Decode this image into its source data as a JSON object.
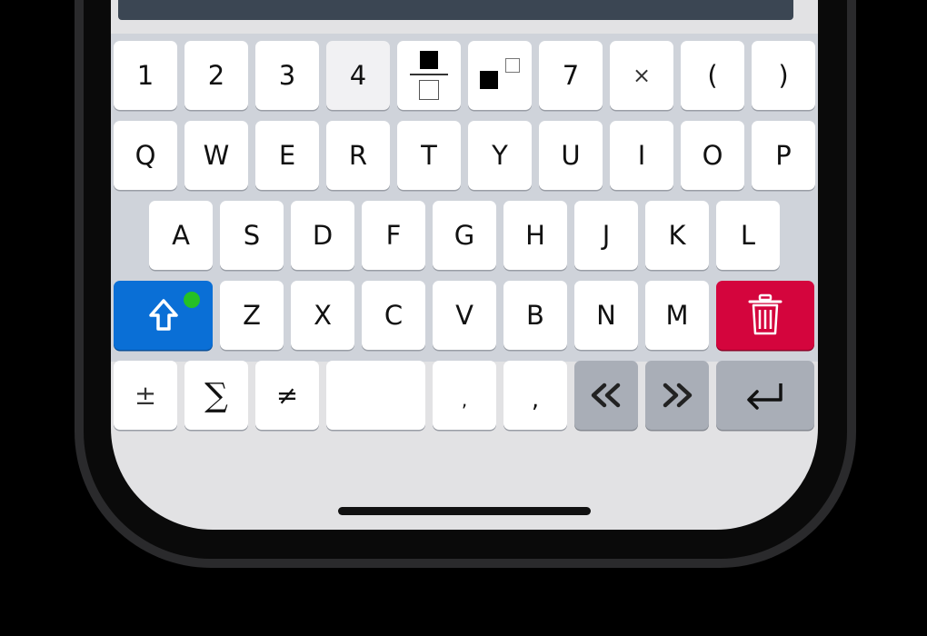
{
  "keyboard": {
    "row1": [
      "1",
      "2",
      "3",
      "4",
      "",
      "",
      " 7",
      "×",
      "(",
      ")"
    ],
    "digits": {
      "k1": "1",
      "k2": "2",
      "k3": "3",
      "k4": "4",
      "k7": "7",
      "times": "×",
      "lparen": "(",
      "rparen": ")"
    },
    "row2": [
      "Q",
      "W",
      "E",
      "R",
      "T",
      "Y",
      "U",
      "I",
      "O",
      "P"
    ],
    "row3": [
      "A",
      "S",
      "D",
      "F",
      "G",
      "H",
      "J",
      "K",
      "L"
    ],
    "row4": [
      "Z",
      "X",
      "C",
      "V",
      "B",
      "N",
      "M"
    ],
    "row5": {
      "plusminus": "±",
      "sum": "∑",
      "notequal": "≠",
      "comma1": ",",
      "comma2": ","
    },
    "colors": {
      "shift": "#0a6fd6",
      "delete": "#d4053d",
      "indicator": "#25c025",
      "topbar": "#3b4653"
    },
    "icons": {
      "shift": "shift-arrow-icon",
      "delete": "trash-icon",
      "left": "double-chevron-left-icon",
      "right": "double-chevron-right-icon",
      "enter": "return-icon",
      "fraction": "fraction-icon",
      "power": "exponent-icon"
    }
  }
}
